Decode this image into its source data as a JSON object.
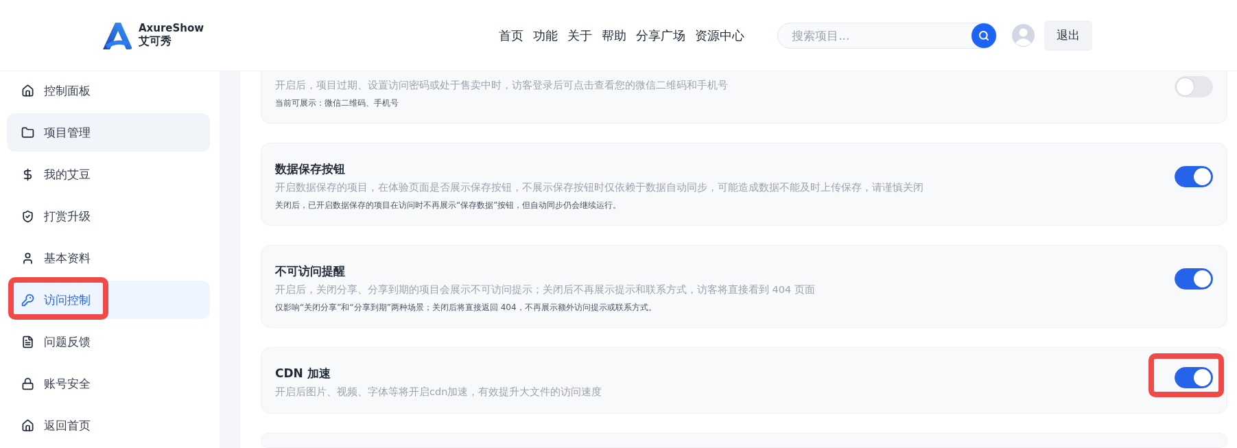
{
  "header": {
    "logo": {
      "name": "AxureShow",
      "subtitle": "艾可秀"
    },
    "nav": [
      "首页",
      "功能",
      "关于",
      "帮助",
      "分享广场",
      "资源中心"
    ],
    "search": {
      "placeholder": "搜索项目..."
    },
    "logout": "退出"
  },
  "sidebar": {
    "items": [
      {
        "label": "控制面板",
        "selected": false,
        "hovered": false,
        "annotated": false
      },
      {
        "label": "项目管理",
        "selected": false,
        "hovered": true,
        "annotated": false
      },
      {
        "label": "我的艾豆",
        "selected": false,
        "hovered": false,
        "annotated": false
      },
      {
        "label": "打赏升级",
        "selected": false,
        "hovered": false,
        "annotated": false
      },
      {
        "label": "基本资料",
        "selected": false,
        "hovered": false,
        "annotated": false
      },
      {
        "label": "访问控制",
        "selected": true,
        "hovered": false,
        "annotated": true
      },
      {
        "label": "问题反馈",
        "selected": false,
        "hovered": false,
        "annotated": false
      },
      {
        "label": "账号安全",
        "selected": false,
        "hovered": false,
        "annotated": false
      },
      {
        "label": "返回首页",
        "selected": false,
        "hovered": false,
        "annotated": false
      }
    ]
  },
  "settings": [
    {
      "description": "开启后，项目过期、设置访问密码或处于售卖中时，访客登录后可点击查看您的微信二维码和手机号",
      "note": "当前可展示：微信二维码、手机号",
      "on": false,
      "annotated": false
    },
    {
      "title": "数据保存按钮",
      "description": "开启数据保存的项目，在体验页面是否展示保存按钮，不展示保存按钮时仅依赖于数据自动同步，可能造成数据不能及时上传保存，请谨慎关闭",
      "note": "关闭后，已开启数据保存的项目在访问时不再展示“保存数据”按钮，但自动同步仍会继续运行。",
      "on": true,
      "annotated": false
    },
    {
      "title": "不可访问提醒",
      "description": "开启后，关闭分享、分享到期的项目会展示不可访问提示；关闭后不再展示提示和联系方式，访客将直接看到 404 页面",
      "note": "仅影响“关闭分享”和“分享到期”两种场景；关闭后将直接返回 404，不再展示额外访问提示或联系方式。",
      "on": true,
      "annotated": false
    },
    {
      "title": "CDN 加速",
      "description": "开启后图片、视频、字体等将开启cdn加速，有效提升大文件的访问速度",
      "on": true,
      "annotated": true
    }
  ]
}
